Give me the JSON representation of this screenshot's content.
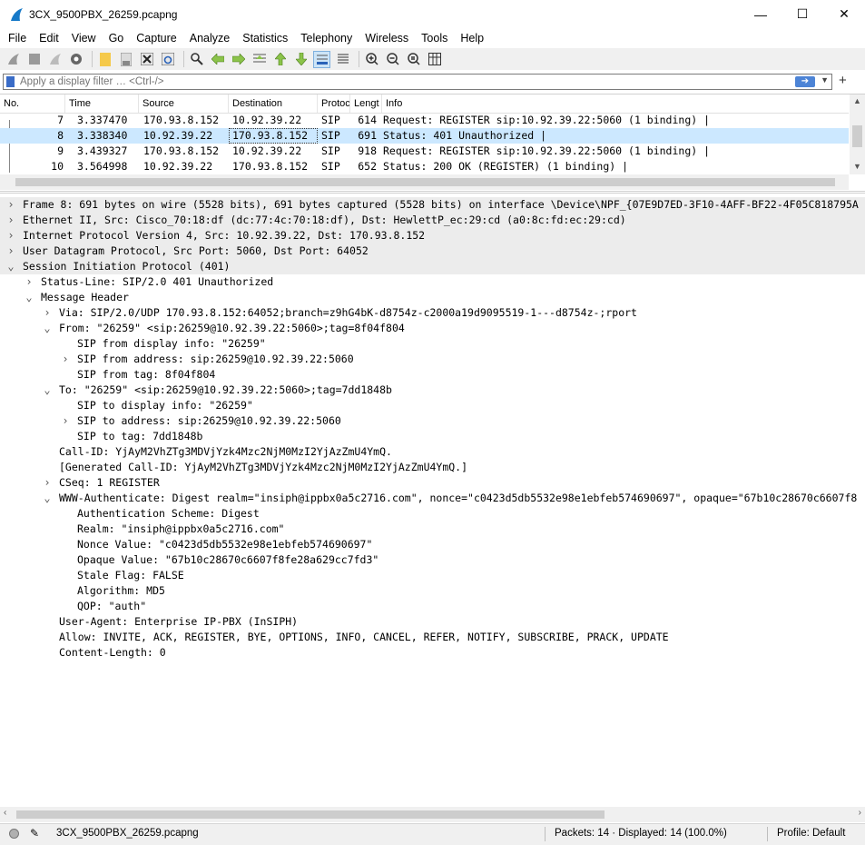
{
  "window": {
    "title": "3CX_9500PBX_26259.pcapng",
    "minimize": "—",
    "maximize": "☐",
    "close": "✕"
  },
  "menu": [
    "File",
    "Edit",
    "View",
    "Go",
    "Capture",
    "Analyze",
    "Statistics",
    "Telephony",
    "Wireless",
    "Tools",
    "Help"
  ],
  "filter": {
    "placeholder": "Apply a display filter … <Ctrl-/>"
  },
  "packet_list": {
    "columns": [
      "No.",
      "Time",
      "Source",
      "Destination",
      "Protoc",
      "Lengt",
      "Info"
    ],
    "rows": [
      {
        "no": "7",
        "time": "3.337470",
        "src": "170.93.8.152",
        "dst": "10.92.39.22",
        "proto": "SIP",
        "len": "614",
        "info": "Request: REGISTER sip:10.92.39.22:5060  (1 binding) |"
      },
      {
        "no": "8",
        "time": "3.338340",
        "src": "10.92.39.22",
        "dst": "170.93.8.152",
        "proto": "SIP",
        "len": "691",
        "info": "Status: 401 Unauthorized |"
      },
      {
        "no": "9",
        "time": "3.439327",
        "src": "170.93.8.152",
        "dst": "10.92.39.22",
        "proto": "SIP",
        "len": "918",
        "info": "Request: REGISTER sip:10.92.39.22:5060  (1 binding) |"
      },
      {
        "no": "10",
        "time": "3.564998",
        "src": "10.92.39.22",
        "dst": "170.93.8.152",
        "proto": "SIP",
        "len": "652",
        "info": "Status: 200 OK (REGISTER)  (1 binding) |"
      }
    ]
  },
  "details": [
    {
      "level": 0,
      "arrow": "›",
      "shade": true,
      "text": "Frame 8: 691 bytes on wire (5528 bits), 691 bytes captured (5528 bits) on interface \\Device\\NPF_{07E9D7ED-3F10-4AFF-BF22-4F05C818795A"
    },
    {
      "level": 0,
      "arrow": "›",
      "shade": true,
      "text": "Ethernet II, Src: Cisco_70:18:df (dc:77:4c:70:18:df), Dst: HewlettP_ec:29:cd (a0:8c:fd:ec:29:cd)"
    },
    {
      "level": 0,
      "arrow": "›",
      "shade": true,
      "text": "Internet Protocol Version 4, Src: 10.92.39.22, Dst: 170.93.8.152"
    },
    {
      "level": 0,
      "arrow": "›",
      "shade": true,
      "text": "User Datagram Protocol, Src Port: 5060, Dst Port: 64052"
    },
    {
      "level": 0,
      "arrow": "⌄",
      "shade": true,
      "text": "Session Initiation Protocol (401)"
    },
    {
      "level": 1,
      "arrow": "›",
      "shade": false,
      "text": "Status-Line: SIP/2.0 401 Unauthorized"
    },
    {
      "level": 1,
      "arrow": "⌄",
      "shade": false,
      "text": "Message Header"
    },
    {
      "level": 2,
      "arrow": "›",
      "shade": false,
      "text": "Via: SIP/2.0/UDP 170.93.8.152:64052;branch=z9hG4bK-d8754z-c2000a19d9095519-1---d8754z-;rport"
    },
    {
      "level": 2,
      "arrow": "⌄",
      "shade": false,
      "text": "From: \"26259\" <sip:26259@10.92.39.22:5060>;tag=8f04f804"
    },
    {
      "level": 3,
      "arrow": "",
      "shade": false,
      "text": "SIP from display info: \"26259\""
    },
    {
      "level": 3,
      "arrow": "›",
      "shade": false,
      "text": "SIP from address: sip:26259@10.92.39.22:5060"
    },
    {
      "level": 3,
      "arrow": "",
      "shade": false,
      "text": "SIP from tag: 8f04f804"
    },
    {
      "level": 2,
      "arrow": "⌄",
      "shade": false,
      "text": "To: \"26259\" <sip:26259@10.92.39.22:5060>;tag=7dd1848b"
    },
    {
      "level": 3,
      "arrow": "",
      "shade": false,
      "text": "SIP to display info: \"26259\""
    },
    {
      "level": 3,
      "arrow": "›",
      "shade": false,
      "text": "SIP to address: sip:26259@10.92.39.22:5060"
    },
    {
      "level": 3,
      "arrow": "",
      "shade": false,
      "text": "SIP to tag: 7dd1848b"
    },
    {
      "level": 2,
      "arrow": "",
      "shade": false,
      "text": "Call-ID: YjAyM2VhZTg3MDVjYzk4Mzc2NjM0MzI2YjAzZmU4YmQ."
    },
    {
      "level": 2,
      "arrow": "",
      "shade": false,
      "text": "[Generated Call-ID: YjAyM2VhZTg3MDVjYzk4Mzc2NjM0MzI2YjAzZmU4YmQ.]"
    },
    {
      "level": 2,
      "arrow": "›",
      "shade": false,
      "text": "CSeq: 1 REGISTER"
    },
    {
      "level": 2,
      "arrow": "⌄",
      "shade": false,
      "text": "WWW-Authenticate: Digest realm=\"insiph@ippbx0a5c2716.com\", nonce=\"c0423d5db5532e98e1ebfeb574690697\", opaque=\"67b10c28670c6607f8"
    },
    {
      "level": 3,
      "arrow": "",
      "shade": false,
      "text": "Authentication Scheme: Digest"
    },
    {
      "level": 3,
      "arrow": "",
      "shade": false,
      "text": "Realm: \"insiph@ippbx0a5c2716.com\""
    },
    {
      "level": 3,
      "arrow": "",
      "shade": false,
      "text": "Nonce Value: \"c0423d5db5532e98e1ebfeb574690697\""
    },
    {
      "level": 3,
      "arrow": "",
      "shade": false,
      "text": "Opaque Value: \"67b10c28670c6607f8fe28a629cc7fd3\""
    },
    {
      "level": 3,
      "arrow": "",
      "shade": false,
      "text": "Stale Flag: FALSE"
    },
    {
      "level": 3,
      "arrow": "",
      "shade": false,
      "text": "Algorithm: MD5"
    },
    {
      "level": 3,
      "arrow": "",
      "shade": false,
      "text": "QOP: \"auth\""
    },
    {
      "level": 2,
      "arrow": "",
      "shade": false,
      "text": "User-Agent: Enterprise IP-PBX (InSIPH)"
    },
    {
      "level": 2,
      "arrow": "",
      "shade": false,
      "text": "Allow: INVITE, ACK, REGISTER, BYE, OPTIONS, INFO, CANCEL, REFER, NOTIFY, SUBSCRIBE, PRACK, UPDATE"
    },
    {
      "level": 2,
      "arrow": "",
      "shade": false,
      "text": "Content-Length: 0"
    }
  ],
  "status": {
    "file": "3CX_9500PBX_26259.pcapng",
    "packets": "Packets: 14 · Displayed: 14 (100.0%)",
    "profile": "Profile: Default"
  }
}
